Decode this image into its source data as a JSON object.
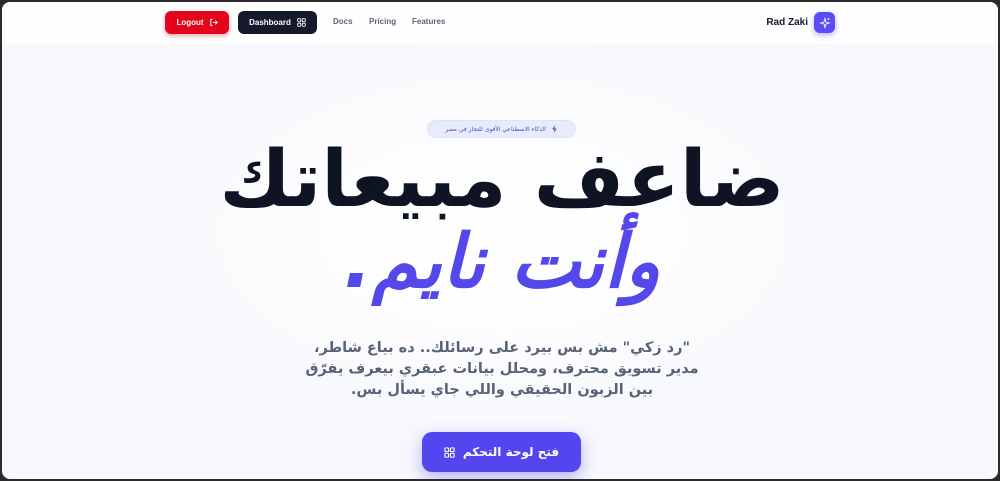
{
  "nav": {
    "logout_label": "Logout",
    "dashboard_label": "Dashboard",
    "links": [
      "Docs",
      "Pricing",
      "Features"
    ],
    "brand_name": "Rad Zaki"
  },
  "hero": {
    "badge": "الذكاء الاصطناعي الأقوى للتجار في مصر",
    "title_line1": "ضاعف مبيعاتك",
    "title_line2": "وأنت نايم.",
    "description": "\"رد زكي\" مش بس بيرد على رسائلك.. ده بياع شاطر، مدير تسويق محترف، ومحلل بيانات عبقري بيعرف يفرّق بين الزبون الحقيقي واللي جاي يسأل بس.",
    "cta_label": "فتح لوحة التحكم"
  },
  "colors": {
    "logout": "#e3061b",
    "dashboard": "#141a2b",
    "accent": "#5548ea",
    "title": "#0f1424",
    "text": "#5a6277"
  },
  "icons": {
    "logout": "logout-arrow-icon",
    "dashboard": "grid-icon",
    "brand": "sparkles-icon",
    "badge": "lightning-icon",
    "cta": "grid-icon"
  }
}
